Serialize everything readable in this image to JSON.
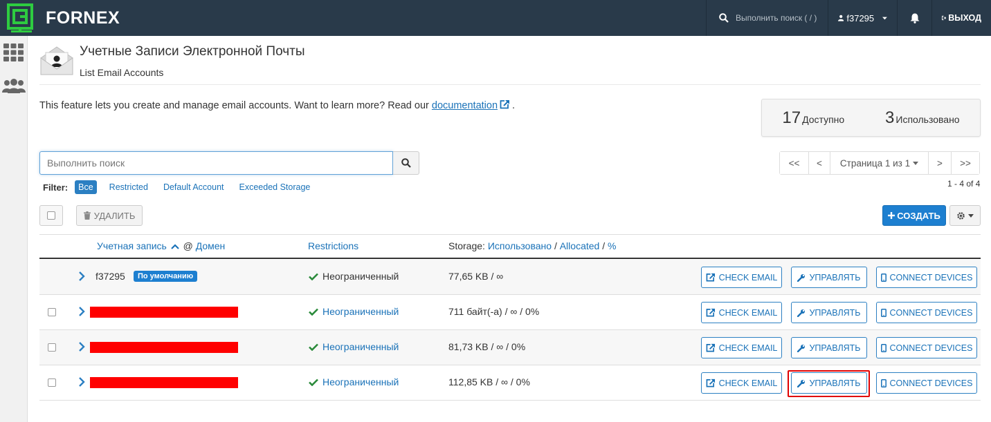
{
  "topbar": {
    "brand": "FORNEX",
    "search_placeholder": "Выполнить поиск ( / )",
    "user": "f37295",
    "logout": "ВЫХОД"
  },
  "header": {
    "title": "Учетные Записи Электронной Почты",
    "subtitle": "List Email Accounts"
  },
  "feature": {
    "text": "This feature lets you create and manage email accounts. Want to learn more? Read our",
    "link": "documentation",
    "suffix": "."
  },
  "stats": {
    "available_num": "17",
    "available_label": "Доступно",
    "used_num": "3",
    "used_label": "Использовано"
  },
  "search": {
    "placeholder": "Выполнить поиск"
  },
  "pager": {
    "first": "<<",
    "prev": "<",
    "page": "Страница 1 из 1",
    "next": ">",
    "last": ">>",
    "range": "1 - 4 of 4"
  },
  "filter": {
    "label": "Filter:",
    "all": "Все",
    "restricted": "Restricted",
    "default": "Default Account",
    "exceeded": "Exceeded Storage"
  },
  "toolbar": {
    "delete": "УДАЛИТЬ",
    "create": "СОЗДАТЬ"
  },
  "table": {
    "col_account": "Учетная запись",
    "col_at": "@",
    "col_domain": "Домен",
    "col_restrictions": "Restrictions",
    "col_storage_prefix": "Storage:",
    "col_used": "Использовано",
    "col_allocated": "Allocated",
    "col_percent": "%",
    "sep": "/",
    "rows": [
      {
        "account": "f37295",
        "badge": "По умолчанию",
        "restriction": "Неограниченный",
        "storage": "77,65 KB / ∞"
      },
      {
        "account": "",
        "restriction": "Неограниченный",
        "storage": "711 байт(-а) / ∞ / 0%"
      },
      {
        "account": "",
        "restriction": "Неограниченный",
        "storage": "81,73 KB / ∞ / 0%"
      },
      {
        "account": "",
        "restriction": "Неограниченный",
        "storage": "112,85 KB / ∞ / 0%"
      }
    ],
    "btn_check": "CHECK EMAIL",
    "btn_manage": "УПРАВЛЯТЬ",
    "btn_connect": "CONNECT DEVICES"
  },
  "colors": {
    "topbar": "#293a4a",
    "accent": "#1d7fd0",
    "logo_green": "#2ecc40",
    "check_green": "#2a8a3a",
    "highlight": "#e00000"
  }
}
